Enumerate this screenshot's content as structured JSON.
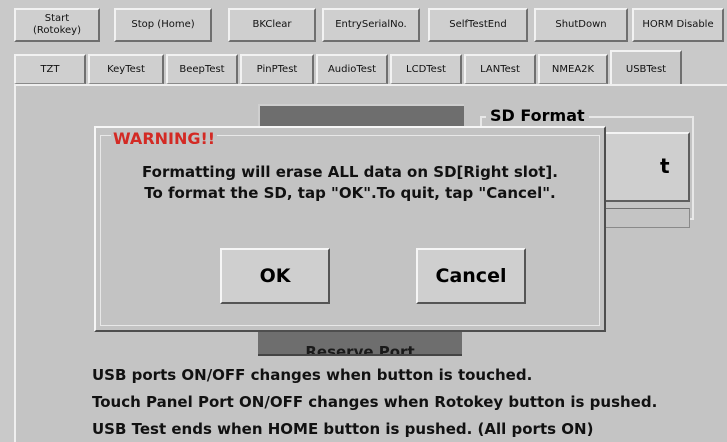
{
  "toolbar": {
    "buttons": [
      "Start\n(Rotokey)",
      "Stop (Home)",
      "BKClear",
      "EntrySerialNo.",
      "SelfTestEnd",
      "ShutDown",
      "HORM Disable"
    ]
  },
  "tabs": {
    "items": [
      "TZT",
      "KeyTest",
      "BeepTest",
      "PinPTest",
      "AudioTest",
      "LCDTest",
      "LANTest",
      "NMEA2K",
      "USBTest"
    ],
    "active": "USBTest"
  },
  "panel": {
    "sd_group_title": "SD Format",
    "sd_format_button_partial": "t",
    "reserve_port_button": "Reserve Port"
  },
  "dialog": {
    "title": "WARNING!!",
    "message_line1": "Formatting will erase ALL data on SD[Right slot].",
    "message_line2": "To format the SD, tap \"OK\".To quit, tap \"Cancel\".",
    "ok_label": "OK",
    "cancel_label": "Cancel"
  },
  "instructions": [
    "USB ports ON/OFF changes when button is touched.",
    "Touch Panel Port ON/OFF changes when Rotokey button is pushed.",
    "USB Test ends when HOME button is pushed. (All ports ON)"
  ],
  "colors": {
    "background": "#c9c9c9",
    "warning_title": "#d32a24",
    "dark_button": "#6e6e6e"
  }
}
